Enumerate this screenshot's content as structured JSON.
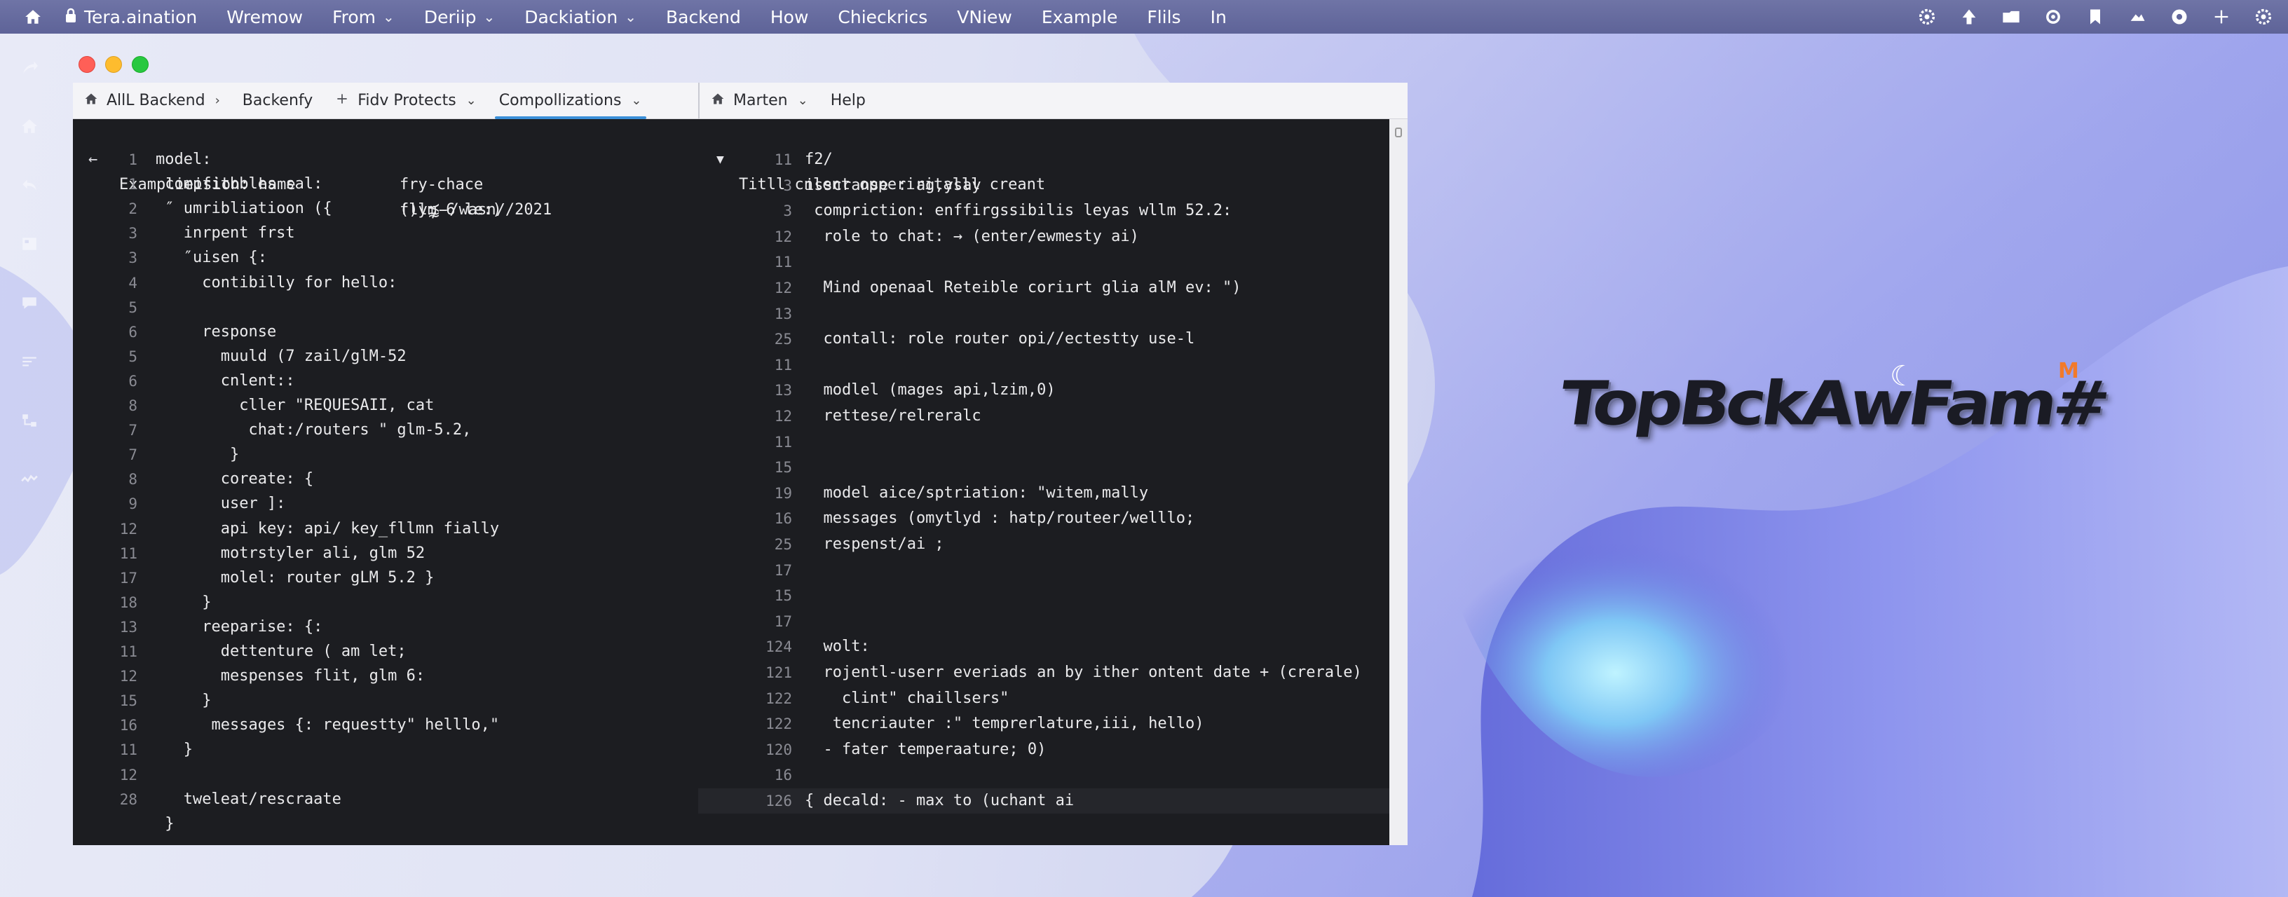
{
  "menubar": {
    "items": [
      {
        "label": "Tera.aination",
        "lock": true
      },
      {
        "label": "Wremow"
      },
      {
        "label": "From",
        "chevron": true
      },
      {
        "label": "Deriip",
        "chevron": true
      },
      {
        "label": "Dackiation",
        "chevron": true
      },
      {
        "label": "Backend"
      },
      {
        "label": "How"
      },
      {
        "label": "Chieckrics"
      },
      {
        "label": "VNiew"
      },
      {
        "label": "Example"
      },
      {
        "label": "Flils"
      },
      {
        "label": "In"
      }
    ],
    "status_icons": [
      "gear-icon",
      "upload-icon",
      "folder-icon",
      "settings-icon",
      "bookmark-icon",
      "cloud-icon",
      "gear-alt-icon",
      "plus-icon",
      "cog-icon"
    ],
    "bg_color": "#62679c"
  },
  "wallpaper": {
    "logo_text": "TopBckAwFam#",
    "accent": "#7a7fe6"
  },
  "dock": {
    "icons": [
      "share-icon",
      "home-icon",
      "undo-icon",
      "grid-icon",
      "chat-icon",
      "cast-icon",
      "branch-icon",
      "wave-icon"
    ]
  },
  "left_tabs": [
    {
      "label": "AllL Backend",
      "icon": "home-icon",
      "chevron": true
    },
    {
      "label": "Backenfy",
      "icon": "",
      "chevron": false
    },
    {
      "label": "Fidv Protects",
      "icon": "plus-icon",
      "chevron": true
    },
    {
      "label": "Compollizations",
      "icon": "",
      "chevron": true,
      "active": true
    }
  ],
  "right_tabs": [
    {
      "label": "Marten",
      "icon": "home-icon",
      "chevron": true
    },
    {
      "label": "Help",
      "icon": "",
      "chevron": false
    }
  ],
  "left_code": {
    "header": {
      "title": "Examplieision: hame",
      "path": "()y⪹-/wasn∕/2021"
    },
    "side_notes": [
      "fry-chace",
      "fllm-6 le:)"
    ],
    "lines": [
      {
        "n": "1",
        "t": "model:"
      },
      {
        "n": "1",
        "t": " compfitbbles sal:"
      },
      {
        "n": "2",
        "t": " ″ umribliatioon ({"
      },
      {
        "n": "3",
        "t": "   inrpent frst"
      },
      {
        "n": "3",
        "t": "   ″uisen {:"
      },
      {
        "n": "4",
        "t": "     contibilly for hello:"
      },
      {
        "n": "5",
        "t": ""
      },
      {
        "n": "6",
        "t": "     response"
      },
      {
        "n": "5",
        "t": "       muuld (7 zail/glM-52"
      },
      {
        "n": "6",
        "t": "       cnlent::"
      },
      {
        "n": "8",
        "t": "         cller \"REQUESAII, cat"
      },
      {
        "n": "7",
        "t": "          chat:/routers \" glm-5.2,"
      },
      {
        "n": "7",
        "t": "        }"
      },
      {
        "n": "8",
        "t": "       coreate: {"
      },
      {
        "n": "9",
        "t": "       user ]:"
      },
      {
        "n": "12",
        "t": "       api key: api/ key_fllmn fially"
      },
      {
        "n": "11",
        "t": "       motrstyler ali, glm 52"
      },
      {
        "n": "17",
        "t": "       molel: router gLM 5.2 }"
      },
      {
        "n": "18",
        "t": "     }"
      },
      {
        "n": "13",
        "t": "     reeparise: {:"
      },
      {
        "n": "11",
        "t": "       dettenture ( am let;"
      },
      {
        "n": "12",
        "t": "       mespenses flit, glm 6:"
      },
      {
        "n": "15",
        "t": "     }"
      },
      {
        "n": "16",
        "t": "      messages {: requestty\" helllo,\""
      },
      {
        "n": "11",
        "t": "   }"
      },
      {
        "n": "12",
        "t": ""
      },
      {
        "n": "28",
        "t": "   tweleat/rescraate"
      },
      {
        "n": "",
        "t": " }"
      }
    ]
  },
  "right_code": {
    "header": {
      "title": "Titll cnlent opperiritalll creant"
    },
    "lines": [
      {
        "n": "11",
        "t": "f2/"
      },
      {
        "n": "3",
        "t": "isscranse : ag,ysay"
      },
      {
        "n": "3",
        "t": " compriction: enffirgssibilis leyas wllm 52.2:"
      },
      {
        "n": "12",
        "t": "  role to chat: → (enter/ewmesty ai)"
      },
      {
        "n": "11",
        "t": ""
      },
      {
        "n": "12",
        "t": "  Mind openaal Reteible coriırt glia alM ev: \")"
      },
      {
        "n": "13",
        "t": ""
      },
      {
        "n": "25",
        "t": "  contall: role router opi//ectestty use-l"
      },
      {
        "n": "11",
        "t": ""
      },
      {
        "n": "13",
        "t": "  modlel (mages api,lzim,0)"
      },
      {
        "n": "12",
        "t": "  rettese/relreralc"
      },
      {
        "n": "11",
        "t": ""
      },
      {
        "n": "15",
        "t": ""
      },
      {
        "n": "19",
        "t": "  model aice/sptriation: \"witem,mally"
      },
      {
        "n": "16",
        "t": "  messages (omytlyd : hatp/routeer/welllo;"
      },
      {
        "n": "25",
        "t": "  respenst/ai ;"
      },
      {
        "n": "17",
        "t": ""
      },
      {
        "n": "15",
        "t": ""
      },
      {
        "n": "17",
        "t": ""
      },
      {
        "n": "124",
        "t": "  wolt:"
      },
      {
        "n": "121",
        "t": "  rojentl-userr everiads an by ither ontent date + (crerale)"
      },
      {
        "n": "122",
        "t": "    clint\" chaillsers\""
      },
      {
        "n": "122",
        "t": "   tencriauter :\" temprerlature,iii, hello)"
      },
      {
        "n": "120",
        "t": "  - fater temperaature; 0)"
      },
      {
        "n": "16",
        "t": ""
      },
      {
        "n": "126",
        "t": "{ decald: - max to (uchant ai"
      }
    ]
  }
}
